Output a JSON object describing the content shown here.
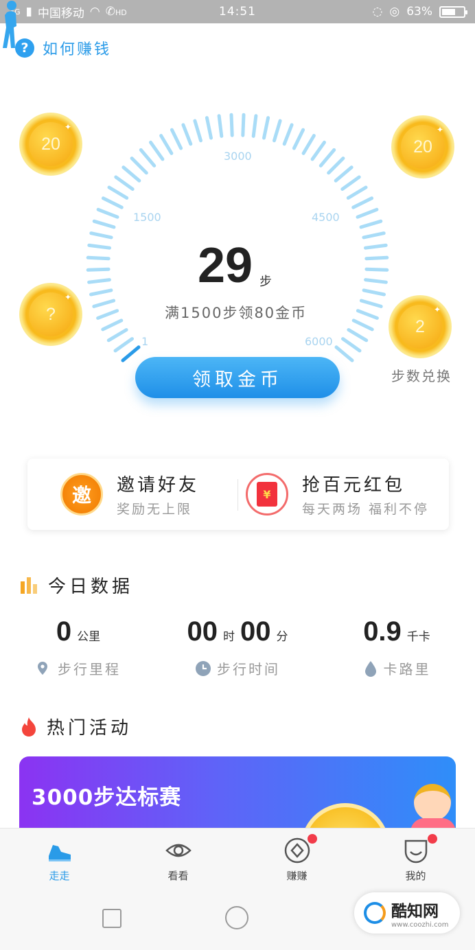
{
  "status_bar": {
    "network": "4G",
    "carrier": "中国移动",
    "hd": "HD",
    "time": "14:51",
    "battery": "63%",
    "battery_level": 0.63
  },
  "help": {
    "label": "如何赚钱"
  },
  "gauge": {
    "ticks": [
      "1",
      "1500",
      "3000",
      "4500",
      "6000"
    ],
    "progress_steps": 29,
    "max_steps": 6000
  },
  "steps": {
    "count": "29",
    "unit": "步",
    "hint": "满1500步领80金币",
    "claim_button": "领取金币"
  },
  "coins": {
    "top_left": "20",
    "top_right": "20",
    "mid_left": "?",
    "mid_right": "2",
    "exchange_label": "步数兑换"
  },
  "promo": {
    "invite_badge": "邀",
    "invite_title": "邀请好友",
    "invite_sub": "奖励无上限",
    "redpack_badge": "¥",
    "redpack_title": "抢百元红包",
    "redpack_sub": "每天两场 福利不停"
  },
  "today": {
    "title": "今日数据",
    "distance_value": "0",
    "distance_unit": "公里",
    "distance_label": "步行里程",
    "hours_value": "00",
    "hours_unit": "时",
    "minutes_value": "00",
    "minutes_unit": "分",
    "time_label": "步行时间",
    "calories_value": "0.9",
    "calories_unit": "千卡",
    "calories_label": "卡路里"
  },
  "activities": {
    "title": "热门活动",
    "banner_title": "3000步达标赛"
  },
  "tabs": [
    {
      "label": "走走",
      "active": true,
      "dot": false
    },
    {
      "label": "看看",
      "active": false,
      "dot": false
    },
    {
      "label": "赚赚",
      "active": false,
      "dot": true
    },
    {
      "label": "我的",
      "active": false,
      "dot": true
    }
  ],
  "watermark": {
    "text": "酷知网",
    "url": "www.coozhi.com"
  },
  "colors": {
    "accent": "#2a9be8",
    "gauge_tick": "#a9dcf7",
    "coin": "#f8b91c",
    "red_dot": "#f23c4a"
  }
}
